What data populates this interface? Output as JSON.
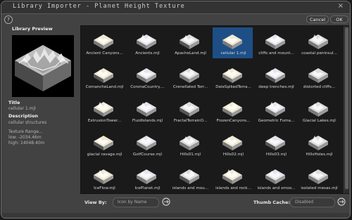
{
  "window": {
    "title": "Library Importer - Planet Height Texture"
  },
  "buttons": {
    "help": "?",
    "cancel": "Cancel",
    "ok": "OK",
    "close": "×"
  },
  "preview": {
    "heading": "Library Preview",
    "title_label": "Title",
    "title_value": "cellular 1.mjl",
    "description_label": "Description",
    "description_value": "cellular structures",
    "texture_range_label": "Texture Range...",
    "low": "low: -2034.46m",
    "high": "high: 14048.40m"
  },
  "grid": {
    "selected_index": 3,
    "items": [
      {
        "label": "Ancient Canyons..."
      },
      {
        "label": "Ancients.mjl"
      },
      {
        "label": "ApacheLand.mjl"
      },
      {
        "label": "cellular 1.mjl"
      },
      {
        "label": "cliffs and mount..."
      },
      {
        "label": "coastal peninsul..."
      },
      {
        "label": "ComancheLand.mjl"
      },
      {
        "label": "CoronaCountry...."
      },
      {
        "label": "Crenellated Terr..."
      },
      {
        "label": "DaleSpikedTerra..."
      },
      {
        "label": "deep trenches.mjl"
      },
      {
        "label": "distorted cliffs..."
      },
      {
        "label": "ExtrusionTower..."
      },
      {
        "label": "FluidIslands.mjl"
      },
      {
        "label": "FractalTerrainO..."
      },
      {
        "label": "FrozenCanyons..."
      },
      {
        "label": "Geometric Fuma..."
      },
      {
        "label": "Glacial Lakes.mjl"
      },
      {
        "label": "glacial ravage.mjl"
      },
      {
        "label": "GolfCourse.mjl"
      },
      {
        "label": "Hills01.mjl"
      },
      {
        "label": "Hills02.mjl"
      },
      {
        "label": "Hills03.mjl"
      },
      {
        "label": "HillsHoles.mjl"
      },
      {
        "label": "IceFlow.mjl"
      },
      {
        "label": "IcePlanet.mjl"
      },
      {
        "label": "islands and mou..."
      },
      {
        "label": "islands and rock..."
      },
      {
        "label": "islands and smoo..."
      },
      {
        "label": "isolated mesas.mjl"
      }
    ]
  },
  "footer": {
    "view_by_label": "View By:",
    "view_by_value": "Icon by Name",
    "thumb_cache_label": "Thumb Cache:",
    "thumb_cache_value": "Disabled"
  },
  "colors": {
    "selection": "#1d4f86",
    "panel": "#424242",
    "grid_bg": "#1a1a1a"
  }
}
